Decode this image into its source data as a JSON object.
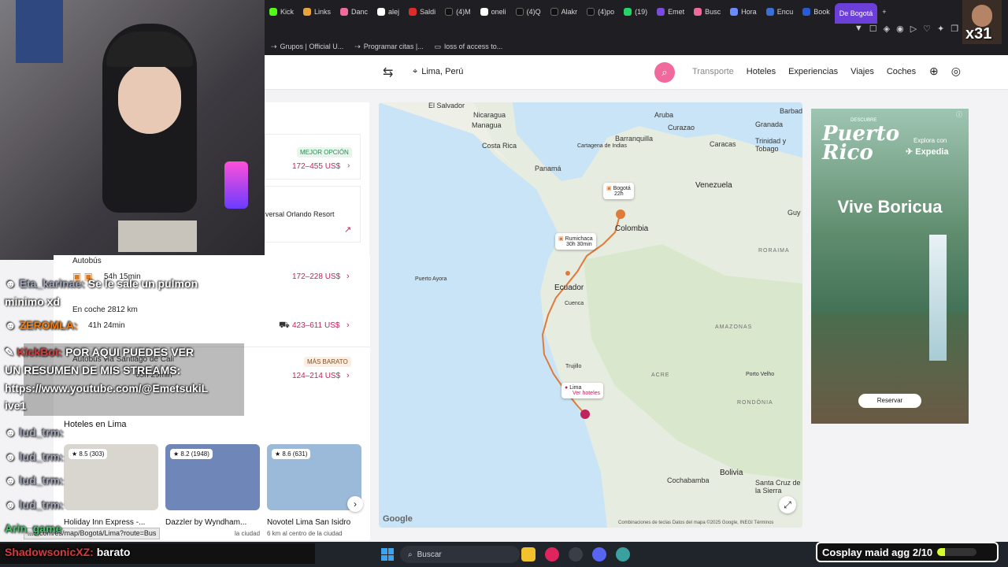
{
  "browser": {
    "tabs": [
      "Kick",
      "Links",
      "Danc",
      "alej",
      "Saldi",
      "(4)M",
      "oneli",
      "(4)Q",
      "Alakr",
      "(4)po",
      "(19)",
      "Emet",
      "Busc",
      "Hora",
      "Encu",
      "Book",
      "De Bogotá"
    ],
    "new_tab": "+",
    "bookmarks": [
      "Grupos | Official U...",
      "Programar citas |...",
      "loss of access to..."
    ],
    "status_url": "...o.com/es/map/Bogotá/Lima?route=Bus"
  },
  "header": {
    "location": "Lima, Perú",
    "nav": [
      "Transporte",
      "Hoteles",
      "Experiencias",
      "Viajes",
      "Coches"
    ]
  },
  "results": {
    "best_badge": "MEJOR OPCIÓN",
    "best_price": "172–455 US$",
    "resort_text": "versal Orlando Resort",
    "bus_title": "Autobús",
    "bus_duration": "54h 15min",
    "bus_price": "172–228 US$",
    "car_title": "En coche 2812 km",
    "car_duration": "41h 24min",
    "car_price": "423–611 US$",
    "cheap_badge": "MÁS BARATO",
    "cali_title": "Autobús vía Santiago de Cali",
    "cali_duration": "65h 29min",
    "cali_price": "124–214 US$"
  },
  "hotels": {
    "title": "Hoteles en Lima",
    "items": [
      {
        "rating": "8.5",
        "reviews": "(303)",
        "name": "Holiday Inn Express -...",
        "sub": "...",
        "color": "#d9d6cf"
      },
      {
        "rating": "8.2",
        "reviews": "(1948)",
        "name": "Dazzler by Wyndham...",
        "sub": "la ciudad",
        "color": "#6e86b8"
      },
      {
        "rating": "8.6",
        "reviews": "(631)",
        "name": "Novotel Lima San Isidro",
        "sub": "6 km al centro de la ciudad",
        "color": "#9bb9d8"
      }
    ]
  },
  "map": {
    "labels": {
      "el_salvador": "El Salvador",
      "nicaragua": "Nicaragua",
      "managua": "Managua",
      "costa_rica": "Costa Rica",
      "panama": "Panamá",
      "aruba": "Aruba",
      "curazao": "Curazao",
      "barranquilla": "Barranquilla",
      "cartagena": "Cartagena de Indias",
      "caracas": "Caracas",
      "granada": "Granada",
      "barbados": "Barbad",
      "trinidad": "Trinidad y Tobago",
      "venezuela": "Venezuela",
      "guy": "Guy",
      "colombia": "Colombia",
      "roraima": "RORAIMA",
      "ecuador": "Ecuador",
      "cuenca": "Cuenca",
      "puerto_ayora": "Puerto Ayora",
      "amazonas": "AMAZONAS",
      "trujillo": "Trujillo",
      "acre": "ACRE",
      "porto_velho": "Porto Velho",
      "rondonia": "RONDÔNIA",
      "bolivia": "Bolivia",
      "cochabamba": "Cochabamba",
      "santa_cruz": "Santa Cruz de la Sierra"
    },
    "pins": {
      "bogota_city": "Bogotá",
      "bogota_time": "22h",
      "rumichaca_city": "Rumichaca",
      "rumichaca_time": "30h 30min",
      "lima_city": "Lima",
      "lima_link": "Ver hoteles"
    },
    "footer": "Combinaciones de teclas   Datos del mapa ©2025 Google, INEGI   Términos",
    "logo": "Google"
  },
  "ad": {
    "kicker": "DESCUBRE",
    "brand": "Puerto Rico",
    "explore": "Explora con",
    "partner": "Expedia",
    "headline": "Vive Boricua",
    "cta": "Reservar"
  },
  "overlay": {
    "chat": [
      {
        "name": "Eta_karinae:",
        "msg": "Se le sale un pulmon"
      },
      {
        "name": "",
        "msg": "minimo xd"
      },
      {
        "name": "ZEROMLA:",
        "msg": ""
      },
      {
        "name": "KickBot:",
        "msg": "POR AQUI PUEDES VER"
      },
      {
        "name": "",
        "msg": "UN RESUMEN DE MIS STREAMS:"
      },
      {
        "name": "",
        "msg": "https://www.youtube.com/@EmetsukiL"
      },
      {
        "name": "",
        "msg": "ive1"
      },
      {
        "name": "lud_trm:",
        "msg": ""
      },
      {
        "name": "lud_trm:",
        "msg": ""
      },
      {
        "name": "lud_trm:",
        "msg": ""
      },
      {
        "name": "lud_trm:",
        "msg": ""
      },
      {
        "name": "Arin_game",
        "msg": ""
      }
    ],
    "last_chat_name": "ShadowsonicXZ:",
    "last_chat_msg": "barato",
    "webcam_corner": "x31",
    "cosplay_goal": "Cosplay maid agg 2/10",
    "cosplay_progress": 0.2
  },
  "taskbar": {
    "search_placeholder": "Buscar"
  }
}
